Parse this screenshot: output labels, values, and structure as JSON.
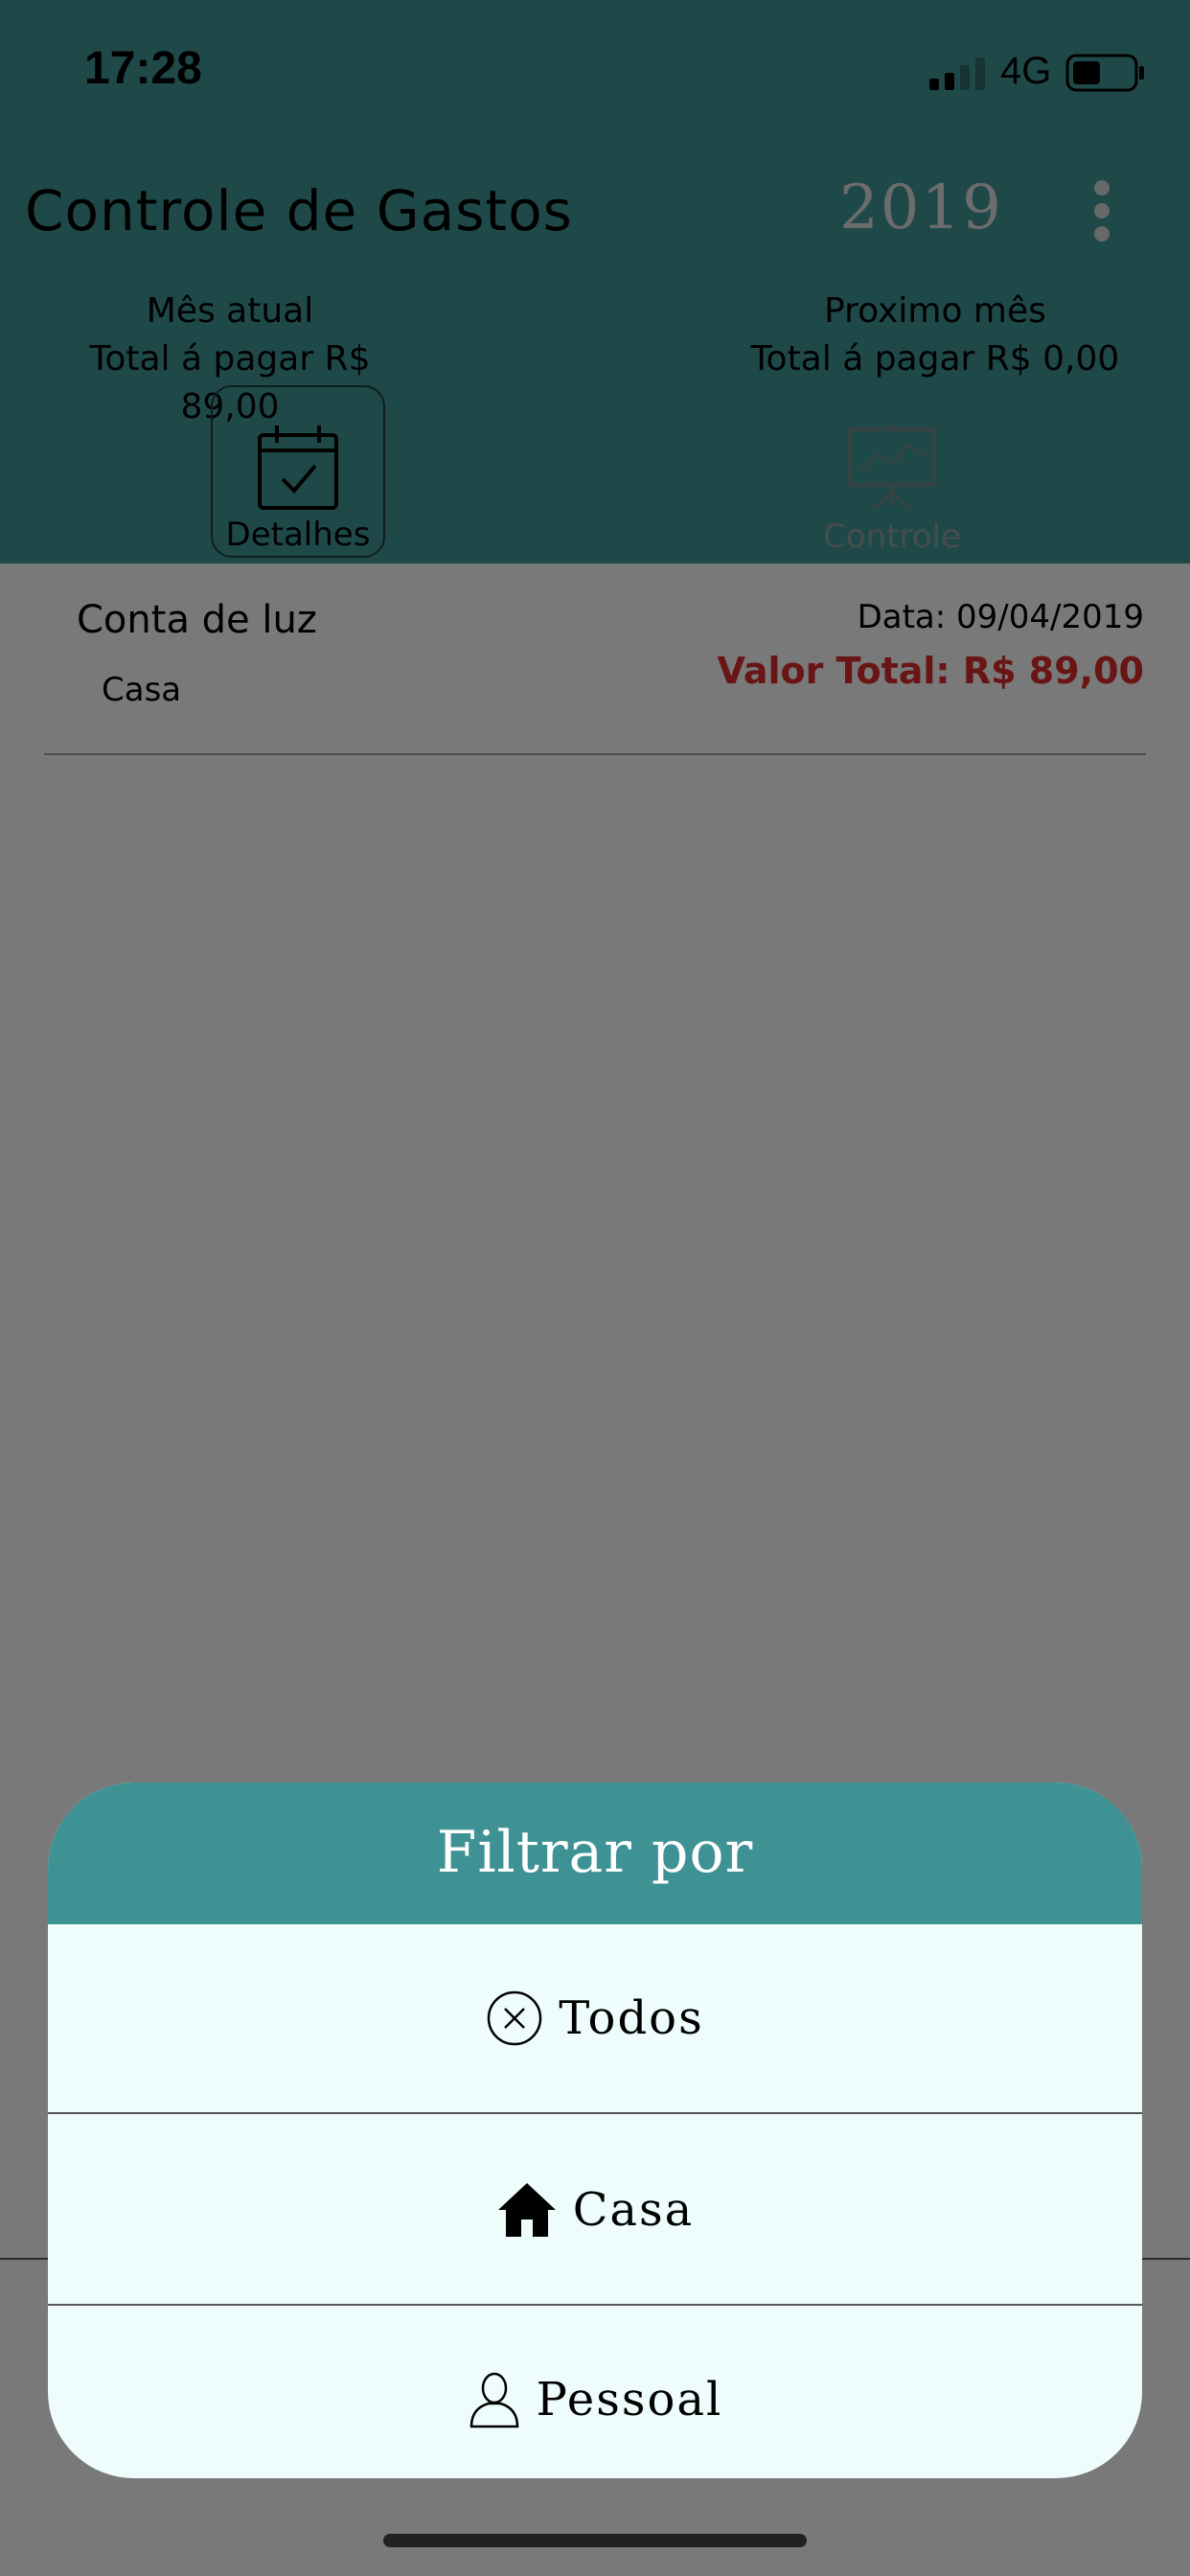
{
  "status_bar": {
    "time": "17:28",
    "network": "4G",
    "signal_icon": "signal-bars-icon",
    "battery_icon": "battery-icon"
  },
  "header": {
    "title": "Controle de Gastos",
    "year": "2019",
    "menu_icon": "more-vertical-icon",
    "current_month": {
      "label": "Mês atual",
      "total_label": "Total á pagar",
      "total_value": "R$ 89,00"
    },
    "next_month": {
      "label": "Proximo mês",
      "total_label": "Total á pagar",
      "total_value": "R$ 0,00"
    },
    "tabs": [
      {
        "label": "Detalhes",
        "icon": "calendar-check-icon",
        "active": true
      },
      {
        "label": "Controle",
        "icon": "presentation-chart-icon",
        "active": false
      }
    ]
  },
  "list": {
    "items": [
      {
        "name": "Conta de luz",
        "category": "Casa",
        "date": "Data: 09/04/2019",
        "total": "Valor Total: R$ 89,00"
      }
    ]
  },
  "filter_sheet": {
    "title": "Filtrar por",
    "options": [
      {
        "label": "Todos",
        "icon": "close-circle-icon"
      },
      {
        "label": "Casa",
        "icon": "home-icon"
      },
      {
        "label": "Pessoal",
        "icon": "person-icon"
      }
    ]
  },
  "colors": {
    "header_bg": "#3f9293",
    "sheet_bg": "#eefdfc",
    "total_red": "#d22b2b",
    "year_color": "#d9d9d9"
  }
}
